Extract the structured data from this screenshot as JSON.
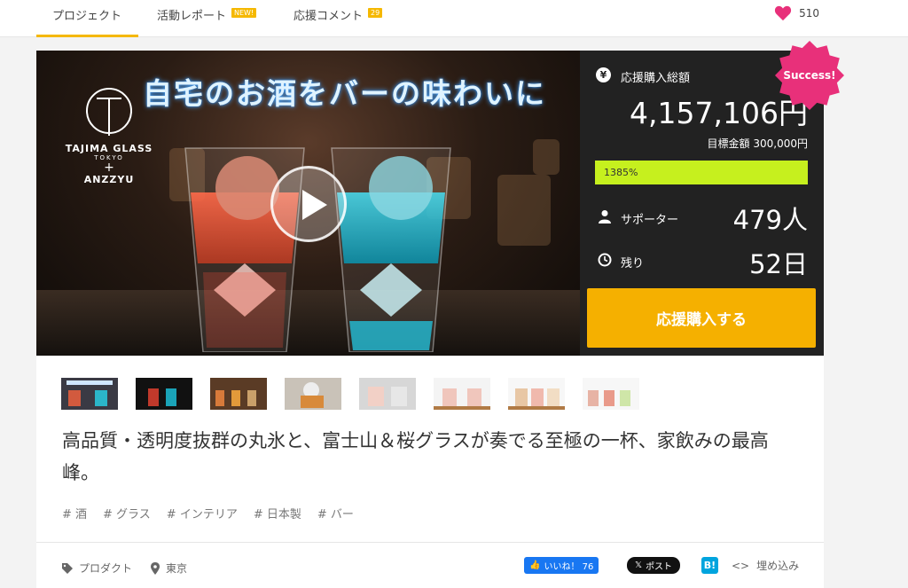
{
  "tabs": [
    {
      "label": "プロジェクト"
    },
    {
      "label": "活動レポート",
      "badge": "NEW!"
    },
    {
      "label": "応援コメント",
      "badge": "29"
    }
  ],
  "like_count": "510",
  "hero": {
    "title": "自宅のお酒をバーの味わいに",
    "logo_name": "TAJIMA GLASS",
    "logo_sub": "TOKYO",
    "logo_plus": "+",
    "logo_brand": "ANZZYU"
  },
  "stats": {
    "total_label": "応援購入総額",
    "total_value": "4,157,106円",
    "goal_text": "目標金額 300,000円",
    "progress_text": "1385%",
    "progress_fraction": 1.0,
    "supporters_label": "サポーター",
    "supporters_value": "479人",
    "remaining_label": "残り",
    "remaining_value": "52日",
    "buy_label": "応援購入する",
    "success_label": "Success!"
  },
  "description": "高品質・透明度抜群の丸氷と、富士山＆桜グラスが奏でる至極の一杯、家飲みの最高峰。",
  "tags": [
    "# 酒",
    "# グラス",
    "# インテリア",
    "# 日本製",
    "# バー"
  ],
  "footer": {
    "category": "プロダクト",
    "location": "東京",
    "fb_label": "いいね！ 76",
    "x_label": "ポスト",
    "hatena_label": "B!",
    "embed_label": "埋め込み"
  },
  "colors": {
    "accent": "#f5b800",
    "heart": "#e8307a",
    "progress": "#c6f01e",
    "success": "#e8307a"
  }
}
